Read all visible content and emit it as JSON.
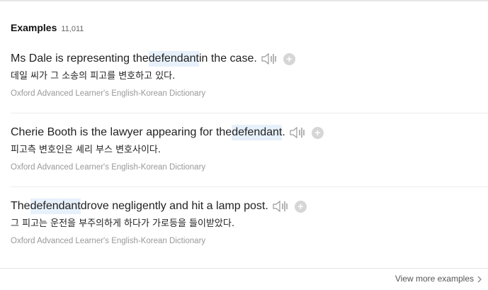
{
  "header": {
    "title": "Examples",
    "count": "11,011"
  },
  "examples": [
    {
      "en_before": "Ms Dale is representing the ",
      "en_highlight": "defendant",
      "en_after": " in the case.",
      "ko": "데일 씨가 그 소송의 피고를 변호하고 있다.",
      "source": "Oxford Advanced Learner's English-Korean Dictionary"
    },
    {
      "en_before": "Cherie Booth is the lawyer appearing for the ",
      "en_highlight": "defendant",
      "en_after": ".",
      "ko": "피고측 변호인은 셰리 부스 변호사이다.",
      "source": "Oxford Advanced Learner's English-Korean Dictionary"
    },
    {
      "en_before": "The ",
      "en_highlight": "defendant",
      "en_after": " drove negligently and hit a lamp post.",
      "ko": "그 피고는 운전을 부주의하게 하다가 가로등을 들이받았다.",
      "source": "Oxford Advanced Learner's English-Korean Dictionary"
    }
  ],
  "footer": {
    "view_more": "View more examples"
  },
  "icons": {
    "speaker": "speaker-icon",
    "add": "plus-circle-icon",
    "chevron": "chevron-right-icon"
  },
  "colors": {
    "highlight": "#e7f1fb",
    "source_text": "#999999",
    "icon_gray": "#c4c4c4"
  }
}
